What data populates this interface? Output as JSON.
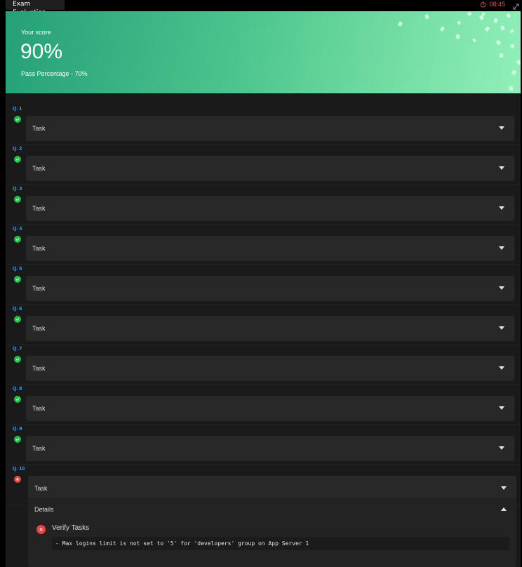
{
  "header": {
    "tab_title": "Exam Evaluation",
    "timer": "08:45"
  },
  "score": {
    "label": "Your score",
    "value": "90%",
    "pass_text": "Pass Percentage - 70%"
  },
  "questions": [
    {
      "number": "Q. 1",
      "title": "Task",
      "status": "passed"
    },
    {
      "number": "Q. 2",
      "title": "Task",
      "status": "passed"
    },
    {
      "number": "Q. 3",
      "title": "Task",
      "status": "passed"
    },
    {
      "number": "Q. 4",
      "title": "Task",
      "status": "passed"
    },
    {
      "number": "Q. 5",
      "title": "Task",
      "status": "passed"
    },
    {
      "number": "Q. 6",
      "title": "Task",
      "status": "passed"
    },
    {
      "number": "Q. 7",
      "title": "Task",
      "status": "passed"
    },
    {
      "number": "Q. 8",
      "title": "Task",
      "status": "passed"
    },
    {
      "number": "Q. 9",
      "title": "Task",
      "status": "passed"
    },
    {
      "number": "Q. 10",
      "title": "Task",
      "status": "failed"
    }
  ],
  "details": {
    "title": "Details",
    "check_title": "Verify Tasks",
    "message": "- Max logins limit is not set to '5' for 'developers' group on App Server 1"
  },
  "colors": {
    "accent_blue": "#3fa4ff",
    "pass_green": "#1fbf4a",
    "fail_red": "#e64545",
    "timer_red": "#f14d4d"
  },
  "icons": {
    "timer": "stopwatch-icon",
    "expand": "expand-icon",
    "passed": "check-circle-icon",
    "failed": "x-circle-icon",
    "collapsed": "chevron-down-icon",
    "expanded": "chevron-up-icon"
  }
}
